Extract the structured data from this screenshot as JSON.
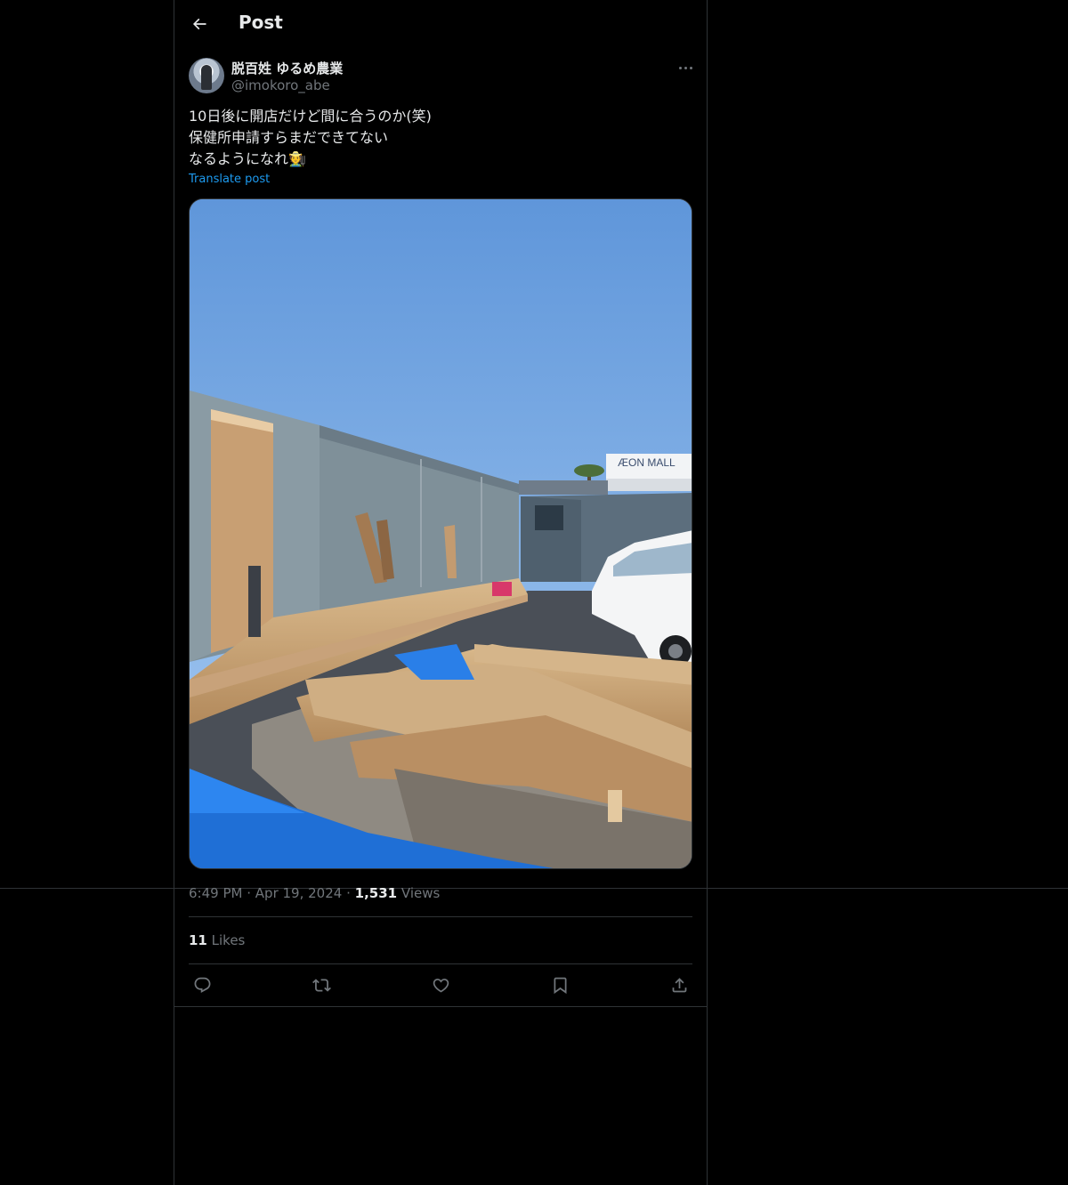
{
  "header": {
    "title": "Post",
    "back_icon": "arrow-left-icon"
  },
  "author": {
    "display_name": "脱百姓 ゆるめ農業",
    "handle": "@imokoro_abe"
  },
  "post": {
    "lines": [
      "10日後に開店だけど間に合うのか(笑)",
      "保健所申請すらまだできてない",
      "なるようになれ🧑‍🌾"
    ],
    "translate_label": "Translate post",
    "photo_sign_text": "ÆON MALL"
  },
  "meta": {
    "time": "6:49 PM",
    "date": "Apr 19, 2024",
    "dot": "·",
    "views_count": "1,531",
    "views_label": "Views"
  },
  "stats": {
    "likes_count": "11",
    "likes_label": "Likes"
  },
  "actions": {
    "icons": [
      "reply-icon",
      "repost-icon",
      "like-icon",
      "bookmark-icon",
      "share-icon"
    ]
  },
  "colors": {
    "background": "#000000",
    "text": "#e7e9ea",
    "muted": "#71767b",
    "link": "#1d9bf0",
    "border": "#2f3336"
  }
}
